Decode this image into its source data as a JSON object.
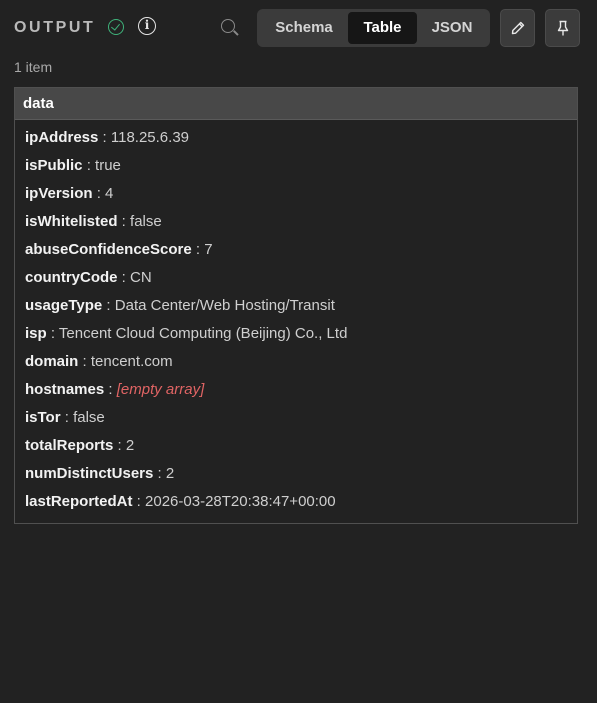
{
  "header": {
    "title": "OUTPUT",
    "status_icon": "check-circle-icon",
    "info_icon": "info-icon",
    "search_icon": "search-icon",
    "tabs": [
      {
        "label": "Schema",
        "active": false
      },
      {
        "label": "Table",
        "active": true
      },
      {
        "label": "JSON",
        "active": false
      }
    ],
    "edit_icon": "pencil-icon",
    "pin_icon": "pin-icon"
  },
  "item_count": "1 item",
  "table": {
    "column": "data",
    "separator": " : ",
    "rows": [
      {
        "key": "ipAddress",
        "value": "118.25.6.39"
      },
      {
        "key": "isPublic",
        "value": "true"
      },
      {
        "key": "ipVersion",
        "value": "4"
      },
      {
        "key": "isWhitelisted",
        "value": "false"
      },
      {
        "key": "abuseConfidenceScore",
        "value": "7"
      },
      {
        "key": "countryCode",
        "value": "CN"
      },
      {
        "key": "usageType",
        "value": "Data Center/Web Hosting/Transit"
      },
      {
        "key": "isp",
        "value": "Tencent Cloud Computing (Beijing) Co., Ltd"
      },
      {
        "key": "domain",
        "value": "tencent.com"
      },
      {
        "key": "hostnames",
        "value": "[empty array]"
      },
      {
        "key": "isTor",
        "value": "false"
      },
      {
        "key": "totalReports",
        "value": "2"
      },
      {
        "key": "numDistinctUsers",
        "value": "2"
      },
      {
        "key": "lastReportedAt",
        "value": "2026-03-28T20:38:47+00:00"
      }
    ]
  },
  "colors": {
    "background": "#222222",
    "success": "#3fb27a",
    "empty_value": "#e06464"
  }
}
